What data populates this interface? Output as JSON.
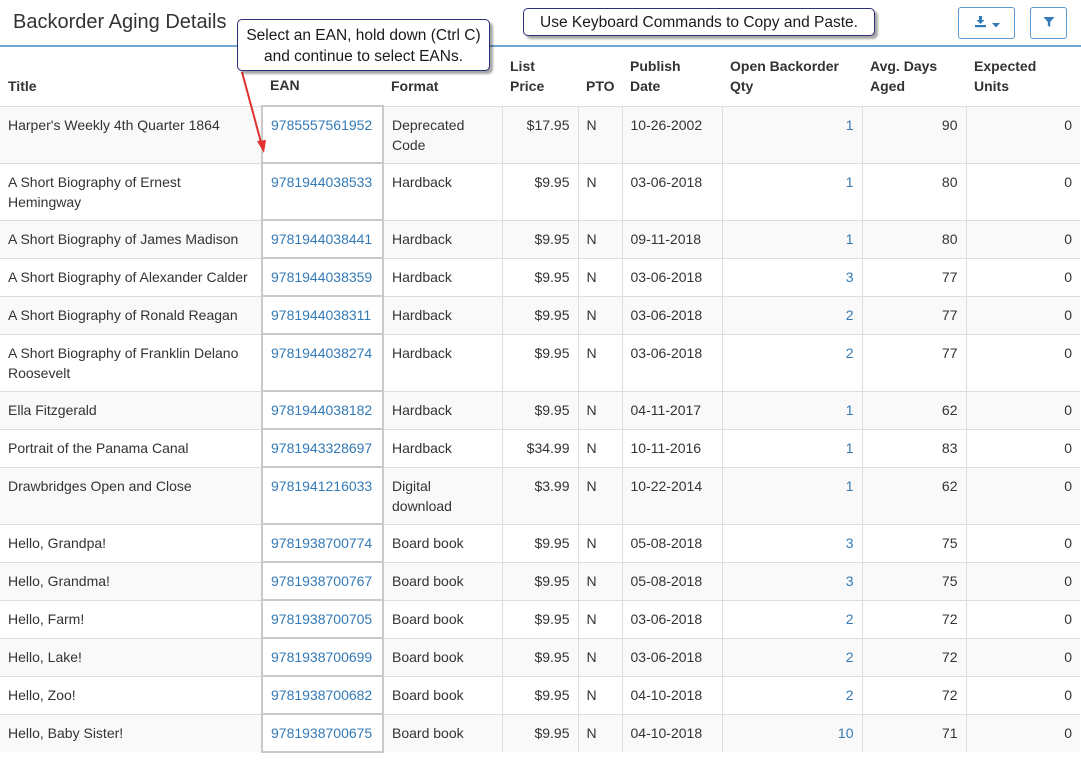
{
  "page": {
    "title": "Backorder Aging Details"
  },
  "callouts": {
    "ean_selection": "Select an EAN, hold down (Ctrl C) and continue to select EANs.",
    "keyboard": "Use Keyboard Commands to Copy and Paste."
  },
  "toolbar": {
    "export_icon": "download-icon",
    "dropdown_icon": "caret-down-icon",
    "filter_icon": "filter-icon",
    "accent_color": "#337ab7"
  },
  "table": {
    "columns": [
      "Title",
      "EAN",
      "Format",
      "List Price",
      "PTO",
      "Publish Date",
      "Open Backorder Qty",
      "Avg. Days Aged",
      "Expected Units"
    ],
    "rows": [
      {
        "title": "Harper's Weekly 4th Quarter 1864",
        "ean": "9785557561952",
        "format": "Deprecated Code",
        "price": "$17.95",
        "pto": "N",
        "date": "10-26-2002",
        "qty": "1",
        "days": "90",
        "units": "0"
      },
      {
        "title": "A Short Biography of Ernest Hemingway",
        "ean": "9781944038533",
        "format": "Hardback",
        "price": "$9.95",
        "pto": "N",
        "date": "03-06-2018",
        "qty": "1",
        "days": "80",
        "units": "0"
      },
      {
        "title": "A Short Biography of James Madison",
        "ean": "9781944038441",
        "format": "Hardback",
        "price": "$9.95",
        "pto": "N",
        "date": "09-11-2018",
        "qty": "1",
        "days": "80",
        "units": "0"
      },
      {
        "title": "A Short Biography of Alexander Calder",
        "ean": "9781944038359",
        "format": "Hardback",
        "price": "$9.95",
        "pto": "N",
        "date": "03-06-2018",
        "qty": "3",
        "days": "77",
        "units": "0"
      },
      {
        "title": "A Short Biography of Ronald Reagan",
        "ean": "9781944038311",
        "format": "Hardback",
        "price": "$9.95",
        "pto": "N",
        "date": "03-06-2018",
        "qty": "2",
        "days": "77",
        "units": "0"
      },
      {
        "title": "A Short Biography of Franklin Delano Roosevelt",
        "ean": "9781944038274",
        "format": "Hardback",
        "price": "$9.95",
        "pto": "N",
        "date": "03-06-2018",
        "qty": "2",
        "days": "77",
        "units": "0"
      },
      {
        "title": "Ella Fitzgerald",
        "ean": "9781944038182",
        "format": "Hardback",
        "price": "$9.95",
        "pto": "N",
        "date": "04-11-2017",
        "qty": "1",
        "days": "62",
        "units": "0"
      },
      {
        "title": "Portrait of the Panama Canal",
        "ean": "9781943328697",
        "format": "Hardback",
        "price": "$34.99",
        "pto": "N",
        "date": "10-11-2016",
        "qty": "1",
        "days": "83",
        "units": "0"
      },
      {
        "title": "Drawbridges Open and Close",
        "ean": "9781941216033",
        "format": "Digital download",
        "price": "$3.99",
        "pto": "N",
        "date": "10-22-2014",
        "qty": "1",
        "days": "62",
        "units": "0"
      },
      {
        "title": "Hello, Grandpa!",
        "ean": "9781938700774",
        "format": "Board book",
        "price": "$9.95",
        "pto": "N",
        "date": "05-08-2018",
        "qty": "3",
        "days": "75",
        "units": "0"
      },
      {
        "title": "Hello, Grandma!",
        "ean": "9781938700767",
        "format": "Board book",
        "price": "$9.95",
        "pto": "N",
        "date": "05-08-2018",
        "qty": "3",
        "days": "75",
        "units": "0"
      },
      {
        "title": "Hello, Farm!",
        "ean": "9781938700705",
        "format": "Board book",
        "price": "$9.95",
        "pto": "N",
        "date": "03-06-2018",
        "qty": "2",
        "days": "72",
        "units": "0"
      },
      {
        "title": "Hello, Lake!",
        "ean": "9781938700699",
        "format": "Board book",
        "price": "$9.95",
        "pto": "N",
        "date": "03-06-2018",
        "qty": "2",
        "days": "72",
        "units": "0"
      },
      {
        "title": "Hello, Zoo!",
        "ean": "9781938700682",
        "format": "Board book",
        "price": "$9.95",
        "pto": "N",
        "date": "04-10-2018",
        "qty": "2",
        "days": "72",
        "units": "0"
      },
      {
        "title": "Hello, Baby Sister!",
        "ean": "9781938700675",
        "format": "Board book",
        "price": "$9.95",
        "pto": "N",
        "date": "04-10-2018",
        "qty": "10",
        "days": "71",
        "units": "0"
      }
    ]
  }
}
